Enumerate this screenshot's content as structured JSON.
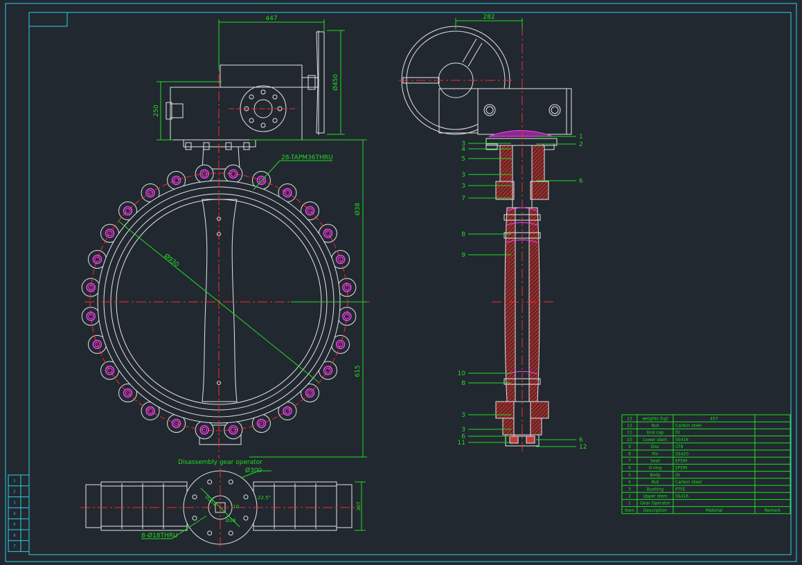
{
  "colors": {
    "background": "#212830",
    "frame": "#2fd0e8",
    "outline": "#e6e6e6",
    "dimension": "#22dd22",
    "centerline": "#ff2a2a",
    "bolt_hole": "#ff40ff",
    "section": "#c83a3a"
  },
  "front_view": {
    "dim_width": "447",
    "dim_handwheel": "Ø450",
    "dim_gear_height": "250",
    "dim_upper": "Ø38",
    "dim_lower": "615",
    "dim_diameter": "Ø930",
    "bolt_note": "28-TAPM36THRU"
  },
  "side_view": {
    "dim_width": "282",
    "callouts_left": [
      "3",
      "4",
      "5",
      "3",
      "3",
      "7",
      "8",
      "9",
      "10",
      "8",
      "3",
      "3",
      "6",
      "11"
    ],
    "callouts_right": [
      "1",
      "2",
      "6",
      "6",
      "12"
    ]
  },
  "bottom_view": {
    "title": "Disassembly gear operator",
    "dim_flange": "Ø300",
    "dim_angle": "22.5°",
    "dim_pcd": "Ø254",
    "dim_small": "Ø38",
    "dim_key": "10",
    "dim_height": "207",
    "bolt_note": "8-Ø18THRU"
  },
  "parts_table": {
    "header_row": [
      "13",
      "weights (kg)",
      "457",
      ""
    ],
    "rows": [
      [
        "12",
        "Nut",
        "Carbon steel",
        ""
      ],
      [
        "11",
        "End cap",
        "DI",
        ""
      ],
      [
        "10",
        "Lower stem",
        "SS416",
        ""
      ],
      [
        "9",
        "Disc",
        "CF8",
        ""
      ],
      [
        "8",
        "Pin",
        "SS420",
        ""
      ],
      [
        "7",
        "Seat",
        "EPDM",
        ""
      ],
      [
        "6",
        "O-ring",
        "EPDM",
        ""
      ],
      [
        "5",
        "Body",
        "DI",
        ""
      ],
      [
        "4",
        "Nut",
        "Carbon steel",
        ""
      ],
      [
        "3",
        "Bushing",
        "PTFE",
        ""
      ],
      [
        "2",
        "Upper stem",
        "SS416",
        ""
      ],
      [
        "1",
        "Gear Operator",
        "",
        ""
      ]
    ],
    "footer_row": [
      "Item",
      "Description",
      "Material",
      "Remark"
    ]
  },
  "side_strip_rows": [
    "1",
    "2",
    "3",
    "4",
    "5",
    "6",
    "7"
  ]
}
